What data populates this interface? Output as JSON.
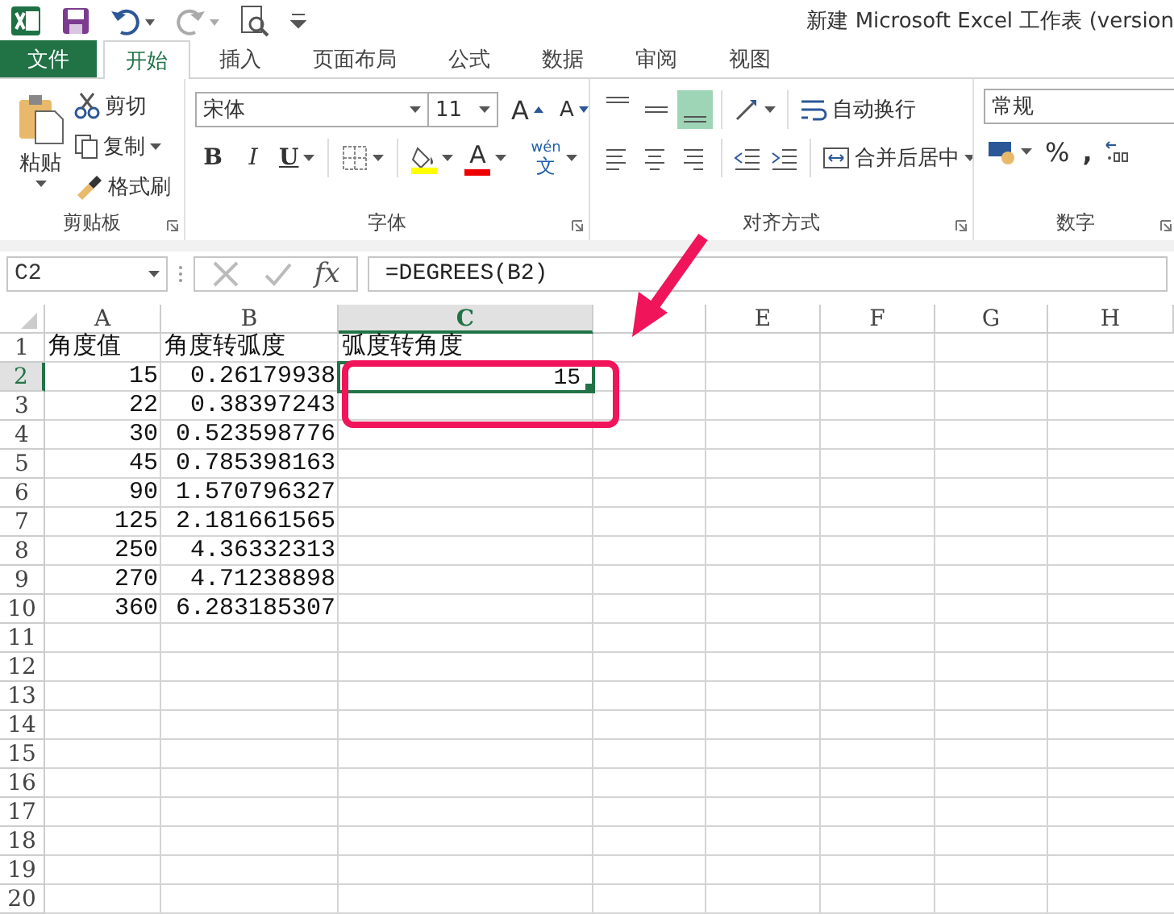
{
  "title_bar": {
    "title": "新建 Microsoft Excel 工作表 (version"
  },
  "tabs": [
    {
      "label": "文件",
      "kind": "file",
      "selected": false
    },
    {
      "label": "开始",
      "kind": "tab",
      "selected": true
    },
    {
      "label": "插入",
      "kind": "tab",
      "selected": false
    },
    {
      "label": "页面布局",
      "kind": "tab",
      "selected": false
    },
    {
      "label": "公式",
      "kind": "tab",
      "selected": false
    },
    {
      "label": "数据",
      "kind": "tab",
      "selected": false
    },
    {
      "label": "审阅",
      "kind": "tab",
      "selected": false
    },
    {
      "label": "视图",
      "kind": "tab",
      "selected": false
    }
  ],
  "clipboard": {
    "paste": "粘贴",
    "cut": "剪切",
    "copy": "复制",
    "format_painter": "格式刷",
    "label": "剪贴板"
  },
  "font": {
    "font_name": "宋体",
    "font_size": "11",
    "grow": "A",
    "shrink": "A",
    "bold": "B",
    "italic": "I",
    "underline": "U",
    "font_color": "A",
    "phonetic_top": "wén",
    "phonetic_bottom": "文",
    "label": "字体"
  },
  "alignment": {
    "vertical": [
      {
        "selected": false
      },
      {
        "selected": false
      },
      {
        "selected": true
      }
    ],
    "wrap": "自动换行",
    "merge": "合并后居中",
    "label": "对齐方式"
  },
  "number": {
    "format": "常规",
    "percent": "%",
    "comma": ",",
    "label": "数字"
  },
  "formula_bar": {
    "name_box": "C2",
    "fx": "fx",
    "formula": "=DEGREES(B2)"
  },
  "sheet": {
    "columns": [
      {
        "label": "A",
        "selected": false
      },
      {
        "label": "B",
        "selected": false
      },
      {
        "label": "C",
        "selected": true
      },
      {
        "selected": false
      },
      {
        "label": "E",
        "selected": false
      },
      {
        "label": "F",
        "selected": false
      },
      {
        "label": "G",
        "selected": false
      },
      {
        "label": "H",
        "selected": false
      }
    ],
    "rows": [
      {
        "number": "1",
        "selected": false,
        "cells": [
          {
            "text": "角度值",
            "kind": "text",
            "selected": false
          },
          {
            "text": "角度转弧度",
            "kind": "text",
            "selected": false
          },
          {
            "text": "弧度转角度",
            "kind": "text",
            "selected": false
          }
        ]
      },
      {
        "number": "2",
        "selected": true,
        "cells": [
          {
            "text": "15",
            "kind": "number",
            "selected": false
          },
          {
            "text": "0.26179938",
            "kind": "number",
            "selected": false
          },
          {
            "text": "15",
            "kind": "number",
            "selected": true
          }
        ]
      },
      {
        "number": "3",
        "selected": false,
        "cells": [
          {
            "text": "22",
            "kind": "number",
            "selected": false
          },
          {
            "text": "0.38397243",
            "kind": "number",
            "selected": false
          }
        ]
      },
      {
        "number": "4",
        "selected": false,
        "cells": [
          {
            "text": "30",
            "kind": "number",
            "selected": false
          },
          {
            "text": "0.523598776",
            "kind": "number",
            "selected": false
          }
        ]
      },
      {
        "number": "5",
        "selected": false,
        "cells": [
          {
            "text": "45",
            "kind": "number",
            "selected": false
          },
          {
            "text": "0.785398163",
            "kind": "number",
            "selected": false
          }
        ]
      },
      {
        "number": "6",
        "selected": false,
        "cells": [
          {
            "text": "90",
            "kind": "number",
            "selected": false
          },
          {
            "text": "1.570796327",
            "kind": "number",
            "selected": false
          }
        ]
      },
      {
        "number": "7",
        "selected": false,
        "cells": [
          {
            "text": "125",
            "kind": "number",
            "selected": false
          },
          {
            "text": "2.181661565",
            "kind": "number",
            "selected": false
          }
        ]
      },
      {
        "number": "8",
        "selected": false,
        "cells": [
          {
            "text": "250",
            "kind": "number",
            "selected": false
          },
          {
            "text": "4.36332313",
            "kind": "number",
            "selected": false
          }
        ]
      },
      {
        "number": "9",
        "selected": false,
        "cells": [
          {
            "text": "270",
            "kind": "number",
            "selected": false
          },
          {
            "text": "4.71238898",
            "kind": "number",
            "selected": false
          }
        ]
      },
      {
        "number": "10",
        "selected": false,
        "cells": [
          {
            "text": "360",
            "kind": "number",
            "selected": false
          },
          {
            "text": "6.283185307",
            "kind": "number",
            "selected": false
          }
        ]
      },
      {
        "number": "11",
        "selected": false
      },
      {
        "number": "12",
        "selected": false
      },
      {
        "number": "13",
        "selected": false
      },
      {
        "number": "14",
        "selected": false
      },
      {
        "number": "15",
        "selected": false
      },
      {
        "number": "16",
        "selected": false
      },
      {
        "number": "17",
        "selected": false
      },
      {
        "number": "18",
        "selected": false
      },
      {
        "number": "19",
        "selected": false
      },
      {
        "number": "20",
        "selected": false
      }
    ]
  }
}
